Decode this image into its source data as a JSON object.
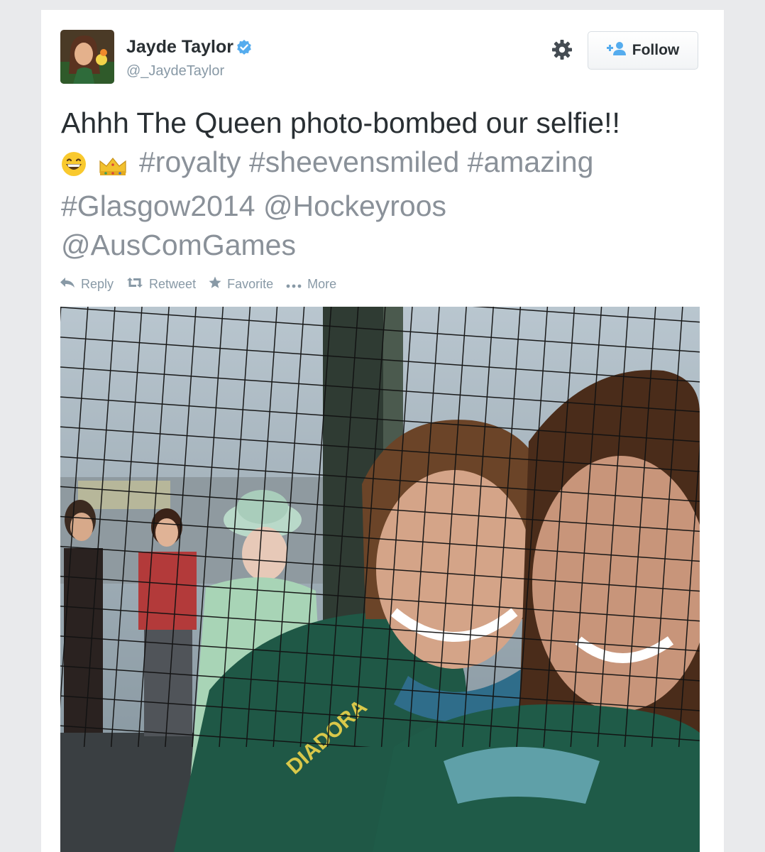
{
  "tweet": {
    "user": {
      "display_name": "Jayde Taylor",
      "screen_name": "@_JaydeTaylor",
      "verified": true,
      "avatar_icon": "profile-avatar"
    },
    "follow_label": "Follow",
    "settings_icon": "gear-icon",
    "text_line1": "Ahhh The Queen photo-bombed our selfie!!",
    "emojis": [
      "grinning-face-emoji",
      "crown-emoji"
    ],
    "hashtags": [
      "#royalty",
      "#sheevensmiled",
      "#amazing",
      "#Glasgow2014"
    ],
    "mentions": [
      "@Hockeyroos",
      "@AusComGames"
    ],
    "actions": [
      {
        "label": "Reply",
        "icon": "reply-icon"
      },
      {
        "label": "Retweet",
        "icon": "retweet-icon"
      },
      {
        "label": "Favorite",
        "icon": "star-icon"
      },
      {
        "label": "More",
        "icon": "more-dots-icon"
      }
    ],
    "photo": {
      "description_icon": "selfie-photo",
      "jersey_text": "DIADORA"
    }
  },
  "colors": {
    "text": "#292f33",
    "muted": "#8899a6",
    "link_gray": "#8a9199",
    "verified_blue": "#55acee",
    "follow_icon_blue": "#55acee",
    "jacket_green": "#1f5846"
  }
}
